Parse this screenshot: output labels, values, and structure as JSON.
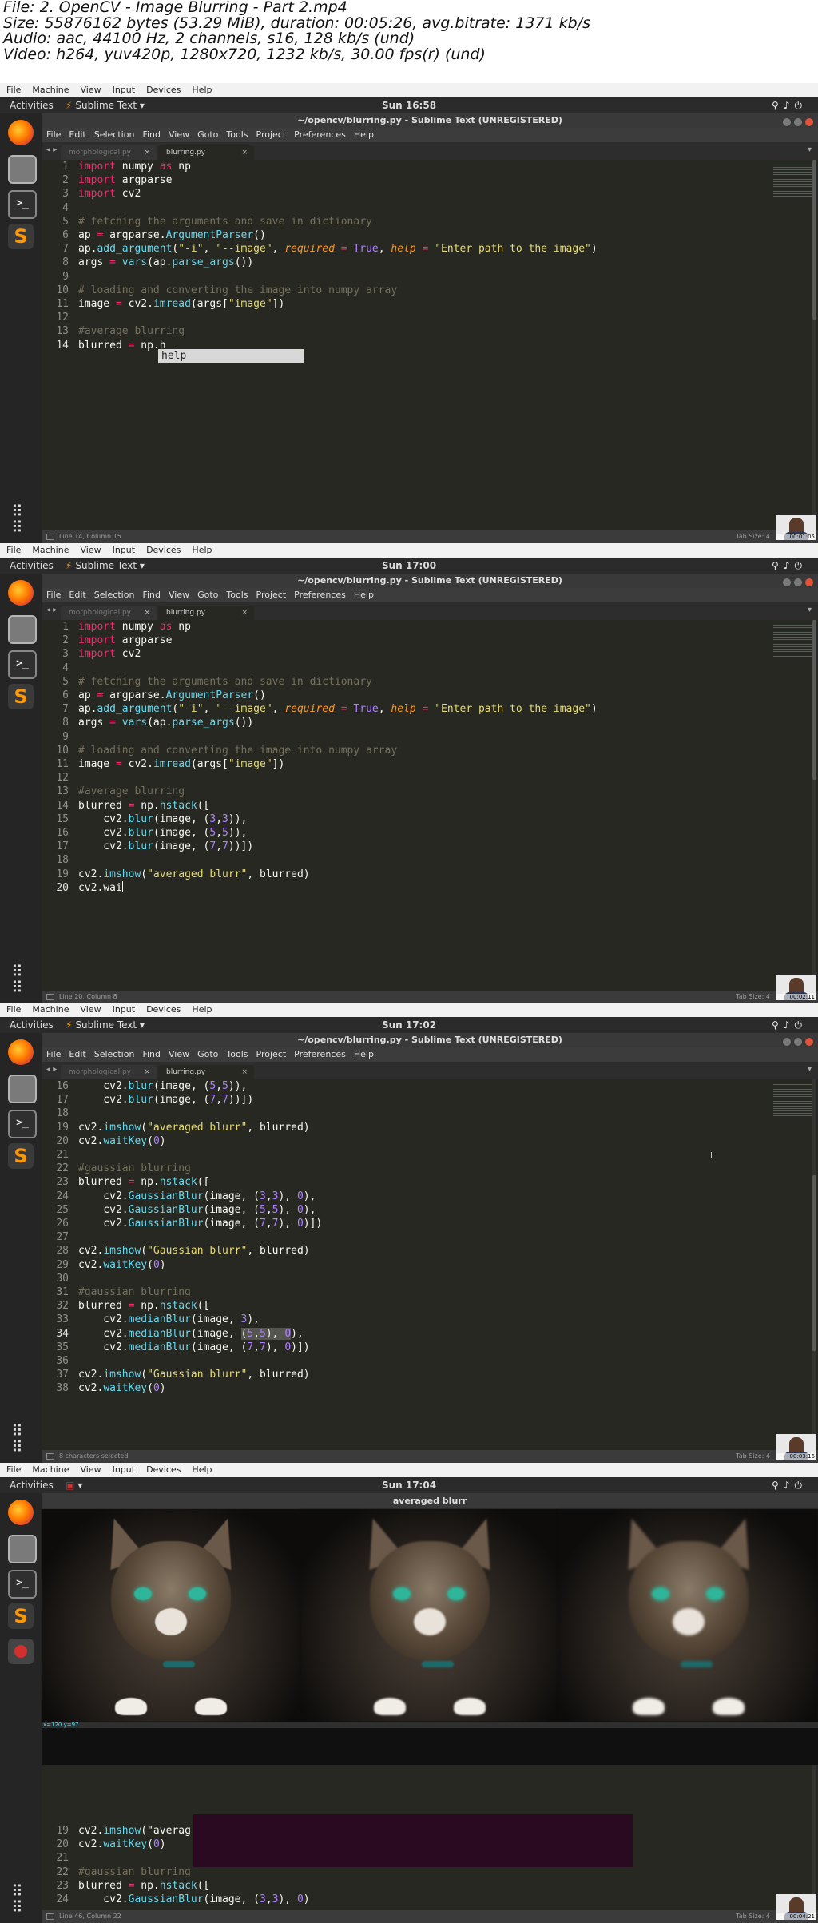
{
  "header": {
    "file": "File: 2. OpenCV - Image Blurring - Part 2.mp4",
    "size": "Size: 55876162 bytes (53.29 MiB), duration: 00:05:26, avg.bitrate: 1371 kb/s",
    "audio": "Audio: aac, 44100 Hz, 2 channels, s16, 128 kb/s (und)",
    "video": "Video: h264, yuv420p, 1280x720, 1232 kb/s, 30.00 fps(r) (und)"
  },
  "vm_menu": [
    "File",
    "Machine",
    "View",
    "Input",
    "Devices",
    "Help"
  ],
  "app_menu": [
    "File",
    "Edit",
    "Selection",
    "Find",
    "View",
    "Goto",
    "Tools",
    "Project",
    "Preferences",
    "Help"
  ],
  "activities": "Activities",
  "app_name": "Sublime Text ▾",
  "window_title": "~/opencv/blurring.py - Sublime Text (UNREGISTERED)",
  "tabs": {
    "inactive": "morphological.py",
    "active": "blurring.py",
    "close": "×"
  },
  "frames": [
    {
      "clock": "Sun 16:58",
      "status_left": "Line 14, Column 15",
      "status_right": "Tab Size: 4",
      "timestamp": "00:01:05",
      "popup": "help"
    },
    {
      "clock": "Sun 17:00",
      "status_left": "Line 20, Column 8",
      "status_right": "Tab Size: 4",
      "timestamp": "00:02:11"
    },
    {
      "clock": "Sun 17:02",
      "status_left": "8 characters selected",
      "status_right": "Tab Size: 4",
      "timestamp": "00:03:16"
    },
    {
      "clock": "Sun 17:04",
      "status_left": "Line 46, Column 22",
      "status_right": "Tab Size: 4",
      "timestamp": "00:04:21",
      "image_window_title": "averaged blurr",
      "coord": "x=120 y=97"
    }
  ],
  "code1": [
    "import numpy as np",
    "import argparse",
    "import cv2",
    "",
    "# fetching the arguments and save in dictionary",
    "ap = argparse.ArgumentParser()",
    "ap.add_argument(\"-i\", \"--image\", required = True, help = \"Enter path to the image\")",
    "args = vars(ap.parse_args())",
    "",
    "# loading and converting the image into numpy array",
    "image = cv2.imread(args[\"image\"])",
    "",
    "#average blurring",
    "blurred = np.h"
  ],
  "code2": [
    "blurred = np.hstack([",
    "    cv2.blur(image, (3,3)),",
    "    cv2.blur(image, (5,5)),",
    "    cv2.blur(image, (7,7))])",
    "",
    "cv2.imshow(\"averaged blurr\", blurred)",
    "cv2.wai"
  ],
  "code3": [
    "    cv2.blur(image, (5,5)),",
    "    cv2.blur(image, (7,7))])",
    "",
    "cv2.imshow(\"averaged blurr\", blurred)",
    "cv2.waitKey(0)",
    "",
    "#gaussian blurring",
    "blurred = np.hstack([",
    "    cv2.GaussianBlur(image, (3,3), 0),",
    "    cv2.GaussianBlur(image, (5,5), 0),",
    "    cv2.GaussianBlur(image, (7,7), 0)])",
    "",
    "cv2.imshow(\"Gaussian blurr\", blurred)",
    "cv2.waitKey(0)",
    "",
    "#gaussian blurring",
    "blurred = np.hstack([",
    "    cv2.medianBlur(image, 3),",
    "    cv2.medianBlur(image, (5,5), 0),",
    "    cv2.medianBlur(image, (7,7), 0)])",
    "",
    "cv2.imshow(\"Gaussian blurr\", blurred)",
    "cv2.waitKey(0)"
  ],
  "code4": [
    "cv2.imshow(\"averag",
    "cv2.waitKey(0)",
    "",
    "#gaussian blurring",
    "blurred = np.hstack([",
    "    cv2.GaussianBlur(image, (3,3), 0)"
  ]
}
